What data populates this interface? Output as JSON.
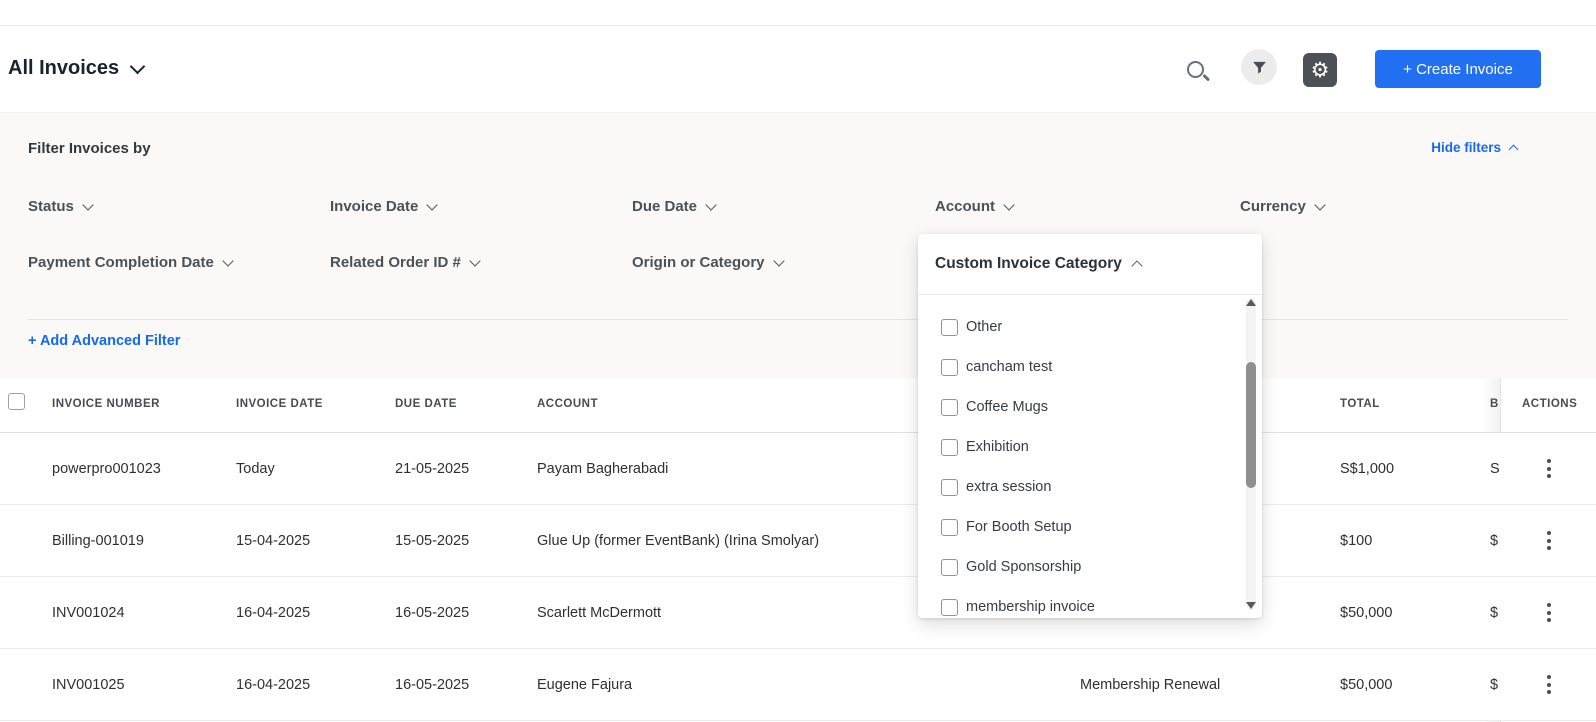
{
  "app_bar": {
    "title": "All Invoices",
    "create_invoice_button": "+ Create Invoice"
  },
  "filter_panel": {
    "title": "Filter Invoices by",
    "hide_filters": "Hide filters",
    "add_advanced_filter": "+ Add Advanced Filter",
    "filters_row1": [
      {
        "label": "Status"
      },
      {
        "label": "Invoice Date"
      },
      {
        "label": "Due Date"
      },
      {
        "label": "Account"
      },
      {
        "label": "Currency"
      }
    ],
    "filters_row2": [
      {
        "label": "Payment Completion Date"
      },
      {
        "label": "Related Order ID #"
      },
      {
        "label": "Origin or Category"
      }
    ],
    "open_filter_dropdown": {
      "label": "Custom Invoice Category",
      "expanded": true,
      "options": [
        {
          "label": "Other",
          "checked": false
        },
        {
          "label": "cancham test",
          "checked": false
        },
        {
          "label": "Coffee Mugs",
          "checked": false
        },
        {
          "label": "Exhibition",
          "checked": false
        },
        {
          "label": "extra session",
          "checked": false
        },
        {
          "label": "For Booth Setup",
          "checked": false
        },
        {
          "label": "Gold Sponsorship",
          "checked": false
        },
        {
          "label": "membership invoice",
          "checked": false
        }
      ]
    }
  },
  "invoice_table": {
    "columns": {
      "invoice_number": "INVOICE NUMBER",
      "invoice_date": "INVOICE DATE",
      "due_date": "DUE DATE",
      "account": "ACCOUNT",
      "total": "TOTAL",
      "balance_partial": "B",
      "actions": "ACTIONS"
    },
    "rows": [
      {
        "invoice_number": "powerpro001023",
        "invoice_date": "Today",
        "due_date": "21-05-2025",
        "account": "Payam Bagherabadi",
        "category": "",
        "total": "S$1,000",
        "balance_partial": "S"
      },
      {
        "invoice_number": "Billing-001019",
        "invoice_date": "15-04-2025",
        "due_date": "15-05-2025",
        "account": "Glue Up (former EventBank) (Irina Smolyar)",
        "category": "",
        "total": "$100",
        "balance_partial": "$"
      },
      {
        "invoice_number": "INV001024",
        "invoice_date": "16-04-2025",
        "due_date": "16-05-2025",
        "account": "Scarlett McDermott",
        "category": "",
        "total": "$50,000",
        "balance_partial": "$"
      },
      {
        "invoice_number": "INV001025",
        "invoice_date": "16-04-2025",
        "due_date": "16-05-2025",
        "account": "Eugene Fajura",
        "category": "Membership Renewal",
        "total": "$50,000",
        "balance_partial": "$"
      }
    ]
  },
  "icons": {
    "search_icon": "magnifying-glass",
    "filter_icon": "funnel",
    "settings_icon": "gear",
    "chevron_down_icon": "chevron-down",
    "chevron_up_icon": "chevron-up",
    "kebab_icon": "vertical-three-dots",
    "checkbox_icon": "empty-checkbox"
  },
  "colors": {
    "accent_blue": "#2170f2",
    "link_blue": "#1569f0"
  }
}
